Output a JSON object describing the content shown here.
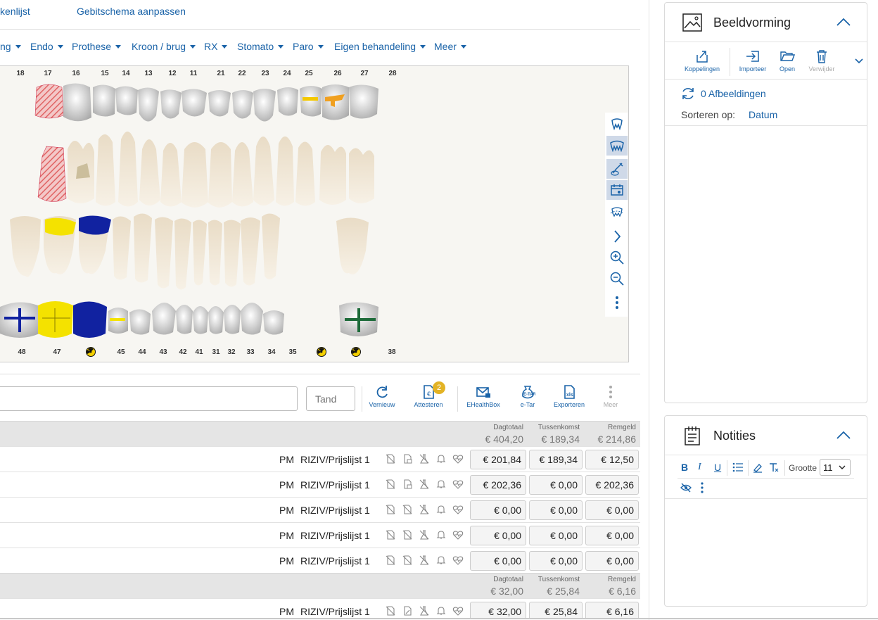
{
  "top_links": [
    "kenlijst",
    "Gebitschema aanpassen"
  ],
  "menu": [
    "ng",
    "Endo",
    "Prothese",
    "Kroon / brug",
    "RX",
    "Stomato",
    "Paro",
    "Eigen behandeling",
    "Meer"
  ],
  "upper_teeth": [
    "18",
    "17",
    "16",
    "15",
    "14",
    "13",
    "12",
    "11",
    "21",
    "22",
    "23",
    "24",
    "25",
    "26",
    "27",
    "28"
  ],
  "lower_teeth": [
    "48",
    "47",
    "45",
    "44",
    "43",
    "42",
    "41",
    "31",
    "32",
    "33",
    "34",
    "35",
    "38"
  ],
  "tand_placeholder": "Tand",
  "actions": [
    {
      "label": "Vernieuw",
      "icon": "refresh-icon"
    },
    {
      "label": "Attesteren",
      "icon": "attest-icon",
      "badge": "2"
    },
    {
      "label": "EHealthBox",
      "icon": "mail-lock-icon"
    },
    {
      "label": "e-Tar",
      "icon": "etar-icon"
    },
    {
      "label": "Exporteren",
      "icon": "xls-icon"
    },
    {
      "label": "Meer",
      "icon": "more-vertical-icon",
      "disabled": true
    }
  ],
  "totals_labels": {
    "day": "Dagtotaal",
    "mid": "Tussenkomst",
    "rem": "Remgeld"
  },
  "groups": [
    {
      "totals": {
        "day": "€ 404,20",
        "mid": "€ 189,34",
        "rem": "€ 214,86"
      },
      "rows": [
        {
          "code": "PM",
          "list": "RIZIV/Prijslijst 1",
          "a1": "€ 201,84",
          "a2": "€ 189,34",
          "a3": "€ 12,50"
        },
        {
          "code": "PM",
          "list": "RIZIV/Prijslijst 1",
          "a1": "€ 202,36",
          "a2": "€ 0,00",
          "a3": "€ 202,36"
        },
        {
          "code": "PM",
          "list": "RIZIV/Prijslijst 1",
          "a1": "€ 0,00",
          "a2": "€ 0,00",
          "a3": "€ 0,00"
        },
        {
          "code": "PM",
          "list": "RIZIV/Prijslijst 1",
          "a1": "€ 0,00",
          "a2": "€ 0,00",
          "a3": "€ 0,00"
        },
        {
          "code": "PM",
          "list": "RIZIV/Prijslijst 1",
          "a1": "€ 0,00",
          "a2": "€ 0,00",
          "a3": "€ 0,00"
        }
      ]
    },
    {
      "totals": {
        "day": "€ 32,00",
        "mid": "€ 25,84",
        "rem": "€ 6,16"
      },
      "rows": [
        {
          "code": "PM",
          "list": "RIZIV/Prijslijst 1",
          "a1": "€ 32,00",
          "a2": "€ 25,84",
          "a3": "€ 6,16"
        }
      ]
    }
  ],
  "imaging": {
    "title": "Beeldvorming",
    "tools": [
      {
        "label": "Koppelingen",
        "icon": "share-icon"
      },
      {
        "label": "Importeer",
        "icon": "import-icon"
      },
      {
        "label": "Open",
        "icon": "folder-open-icon"
      },
      {
        "label": "Verwijder",
        "icon": "trash-icon",
        "disabled": true
      }
    ],
    "count_label": "0 Afbeeldingen",
    "sort_label": "Sorteren op:",
    "sort_value": "Datum"
  },
  "notes": {
    "title": "Notities",
    "size_label": "Grootte",
    "size_value": "11"
  },
  "colors": {
    "accent": "#1a63a8",
    "yellow_fill": "#f4e200",
    "blue_fill": "#1122a0",
    "green_cross": "#1e6b3a",
    "red_hatch": "#e06464",
    "badge": "#e3b325"
  }
}
